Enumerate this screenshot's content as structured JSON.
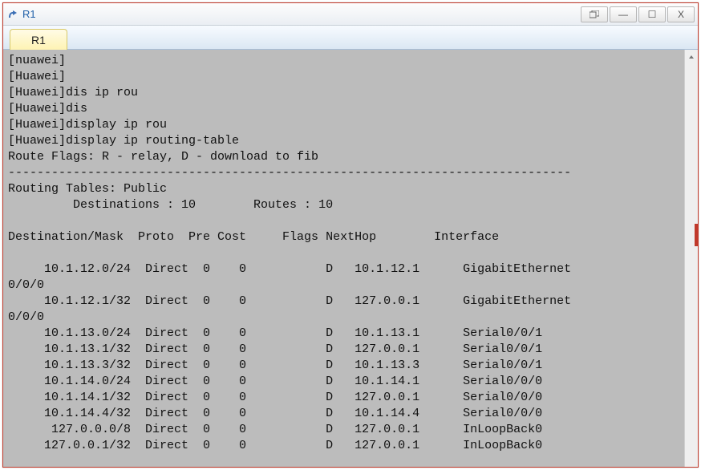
{
  "window": {
    "title": "R1",
    "controls": {
      "popout": "▭",
      "min": "—",
      "max": "☐",
      "close": "X"
    }
  },
  "tabs": [
    {
      "label": "R1"
    }
  ],
  "terminal": {
    "history": [
      "[nuawei]",
      "[Huawei]",
      "[Huawei]dis ip rou",
      "[Huawei]dis",
      "[Huawei]display ip rou",
      "[Huawei]display ip routing-table"
    ],
    "flags_line": "Route Flags: R - relay, D - download to fib",
    "sep": "------------------------------------------------------------------------------",
    "table_title": "Routing Tables: Public",
    "summary_dest_label": "Destinations :",
    "summary_dest_value": "10",
    "summary_routes_label": "Routes :",
    "summary_routes_value": "10",
    "headers": {
      "dest": "Destination/Mask",
      "proto": "Proto",
      "pre": "Pre",
      "cost": "Cost",
      "flags": "Flags",
      "nexthop": "NextHop",
      "iface": "Interface"
    },
    "rows": [
      {
        "dest": "10.1.12.0/24",
        "proto": "Direct",
        "pre": "0",
        "cost": "0",
        "flags": "D",
        "nexthop": "10.1.12.1",
        "iface": "GigabitEthernet",
        "wrap": "0/0/0"
      },
      {
        "dest": "10.1.12.1/32",
        "proto": "Direct",
        "pre": "0",
        "cost": "0",
        "flags": "D",
        "nexthop": "127.0.0.1",
        "iface": "GigabitEthernet",
        "wrap": "0/0/0"
      },
      {
        "dest": "10.1.13.0/24",
        "proto": "Direct",
        "pre": "0",
        "cost": "0",
        "flags": "D",
        "nexthop": "10.1.13.1",
        "iface": "Serial0/0/1"
      },
      {
        "dest": "10.1.13.1/32",
        "proto": "Direct",
        "pre": "0",
        "cost": "0",
        "flags": "D",
        "nexthop": "127.0.0.1",
        "iface": "Serial0/0/1"
      },
      {
        "dest": "10.1.13.3/32",
        "proto": "Direct",
        "pre": "0",
        "cost": "0",
        "flags": "D",
        "nexthop": "10.1.13.3",
        "iface": "Serial0/0/1"
      },
      {
        "dest": "10.1.14.0/24",
        "proto": "Direct",
        "pre": "0",
        "cost": "0",
        "flags": "D",
        "nexthop": "10.1.14.1",
        "iface": "Serial0/0/0"
      },
      {
        "dest": "10.1.14.1/32",
        "proto": "Direct",
        "pre": "0",
        "cost": "0",
        "flags": "D",
        "nexthop": "127.0.0.1",
        "iface": "Serial0/0/0"
      },
      {
        "dest": "10.1.14.4/32",
        "proto": "Direct",
        "pre": "0",
        "cost": "0",
        "flags": "D",
        "nexthop": "10.1.14.4",
        "iface": "Serial0/0/0"
      },
      {
        "dest": "127.0.0.0/8",
        "proto": "Direct",
        "pre": "0",
        "cost": "0",
        "flags": "D",
        "nexthop": "127.0.0.1",
        "iface": "InLoopBack0"
      },
      {
        "dest": "127.0.0.1/32",
        "proto": "Direct",
        "pre": "0",
        "cost": "0",
        "flags": "D",
        "nexthop": "127.0.0.1",
        "iface": "InLoopBack0"
      }
    ]
  }
}
